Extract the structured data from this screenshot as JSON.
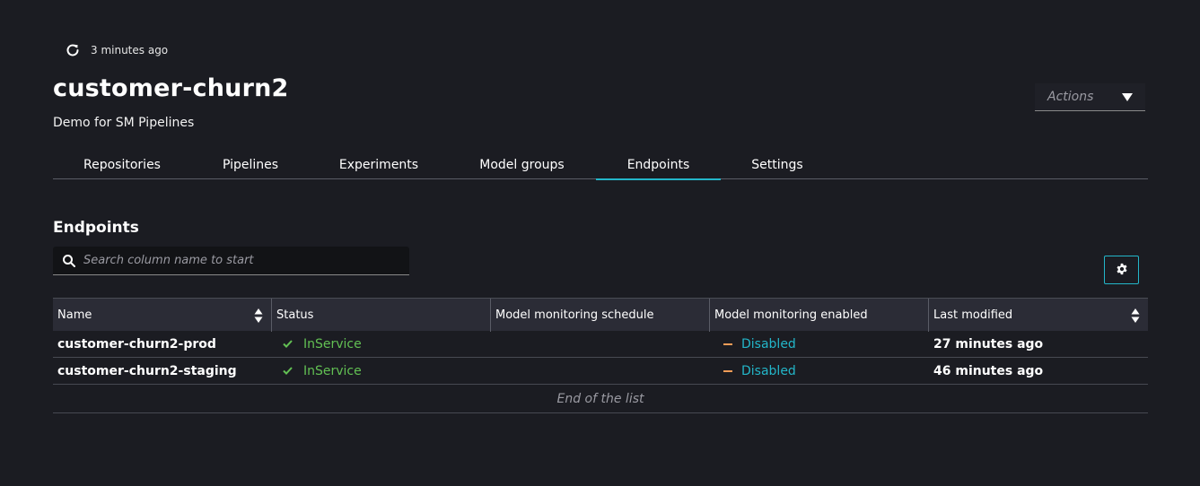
{
  "header": {
    "refresh_text": "3 minutes ago",
    "title": "customer-churn2",
    "description": "Demo for SM Pipelines",
    "actions_label": "Actions"
  },
  "tabs": [
    {
      "label": "Repositories"
    },
    {
      "label": "Pipelines"
    },
    {
      "label": "Experiments"
    },
    {
      "label": "Model groups"
    },
    {
      "label": "Endpoints",
      "active": true
    },
    {
      "label": "Settings"
    }
  ],
  "section": {
    "title": "Endpoints",
    "search_placeholder": "Search column name to start"
  },
  "table": {
    "columns": [
      "Name",
      "Status",
      "Model monitoring schedule",
      "Model monitoring enabled",
      "Last modified"
    ],
    "rows": [
      {
        "name": "customer-churn2-prod",
        "status": "InService",
        "schedule": "",
        "monitoring": "Disabled",
        "modified": "27 minutes ago"
      },
      {
        "name": "customer-churn2-staging",
        "status": "InService",
        "schedule": "",
        "monitoring": "Disabled",
        "modified": "46 minutes ago"
      }
    ],
    "end_text": "End of the list"
  },
  "colors": {
    "accent": "#23b6c9",
    "success": "#62c053",
    "warning": "#f39c57",
    "background": "#1b1c22"
  },
  "icons": {
    "refresh": "refresh-icon",
    "search": "search-icon",
    "settings": "gear-icon",
    "sort": "sort-icon",
    "status_ok": "check-icon",
    "disabled": "dash-icon"
  }
}
